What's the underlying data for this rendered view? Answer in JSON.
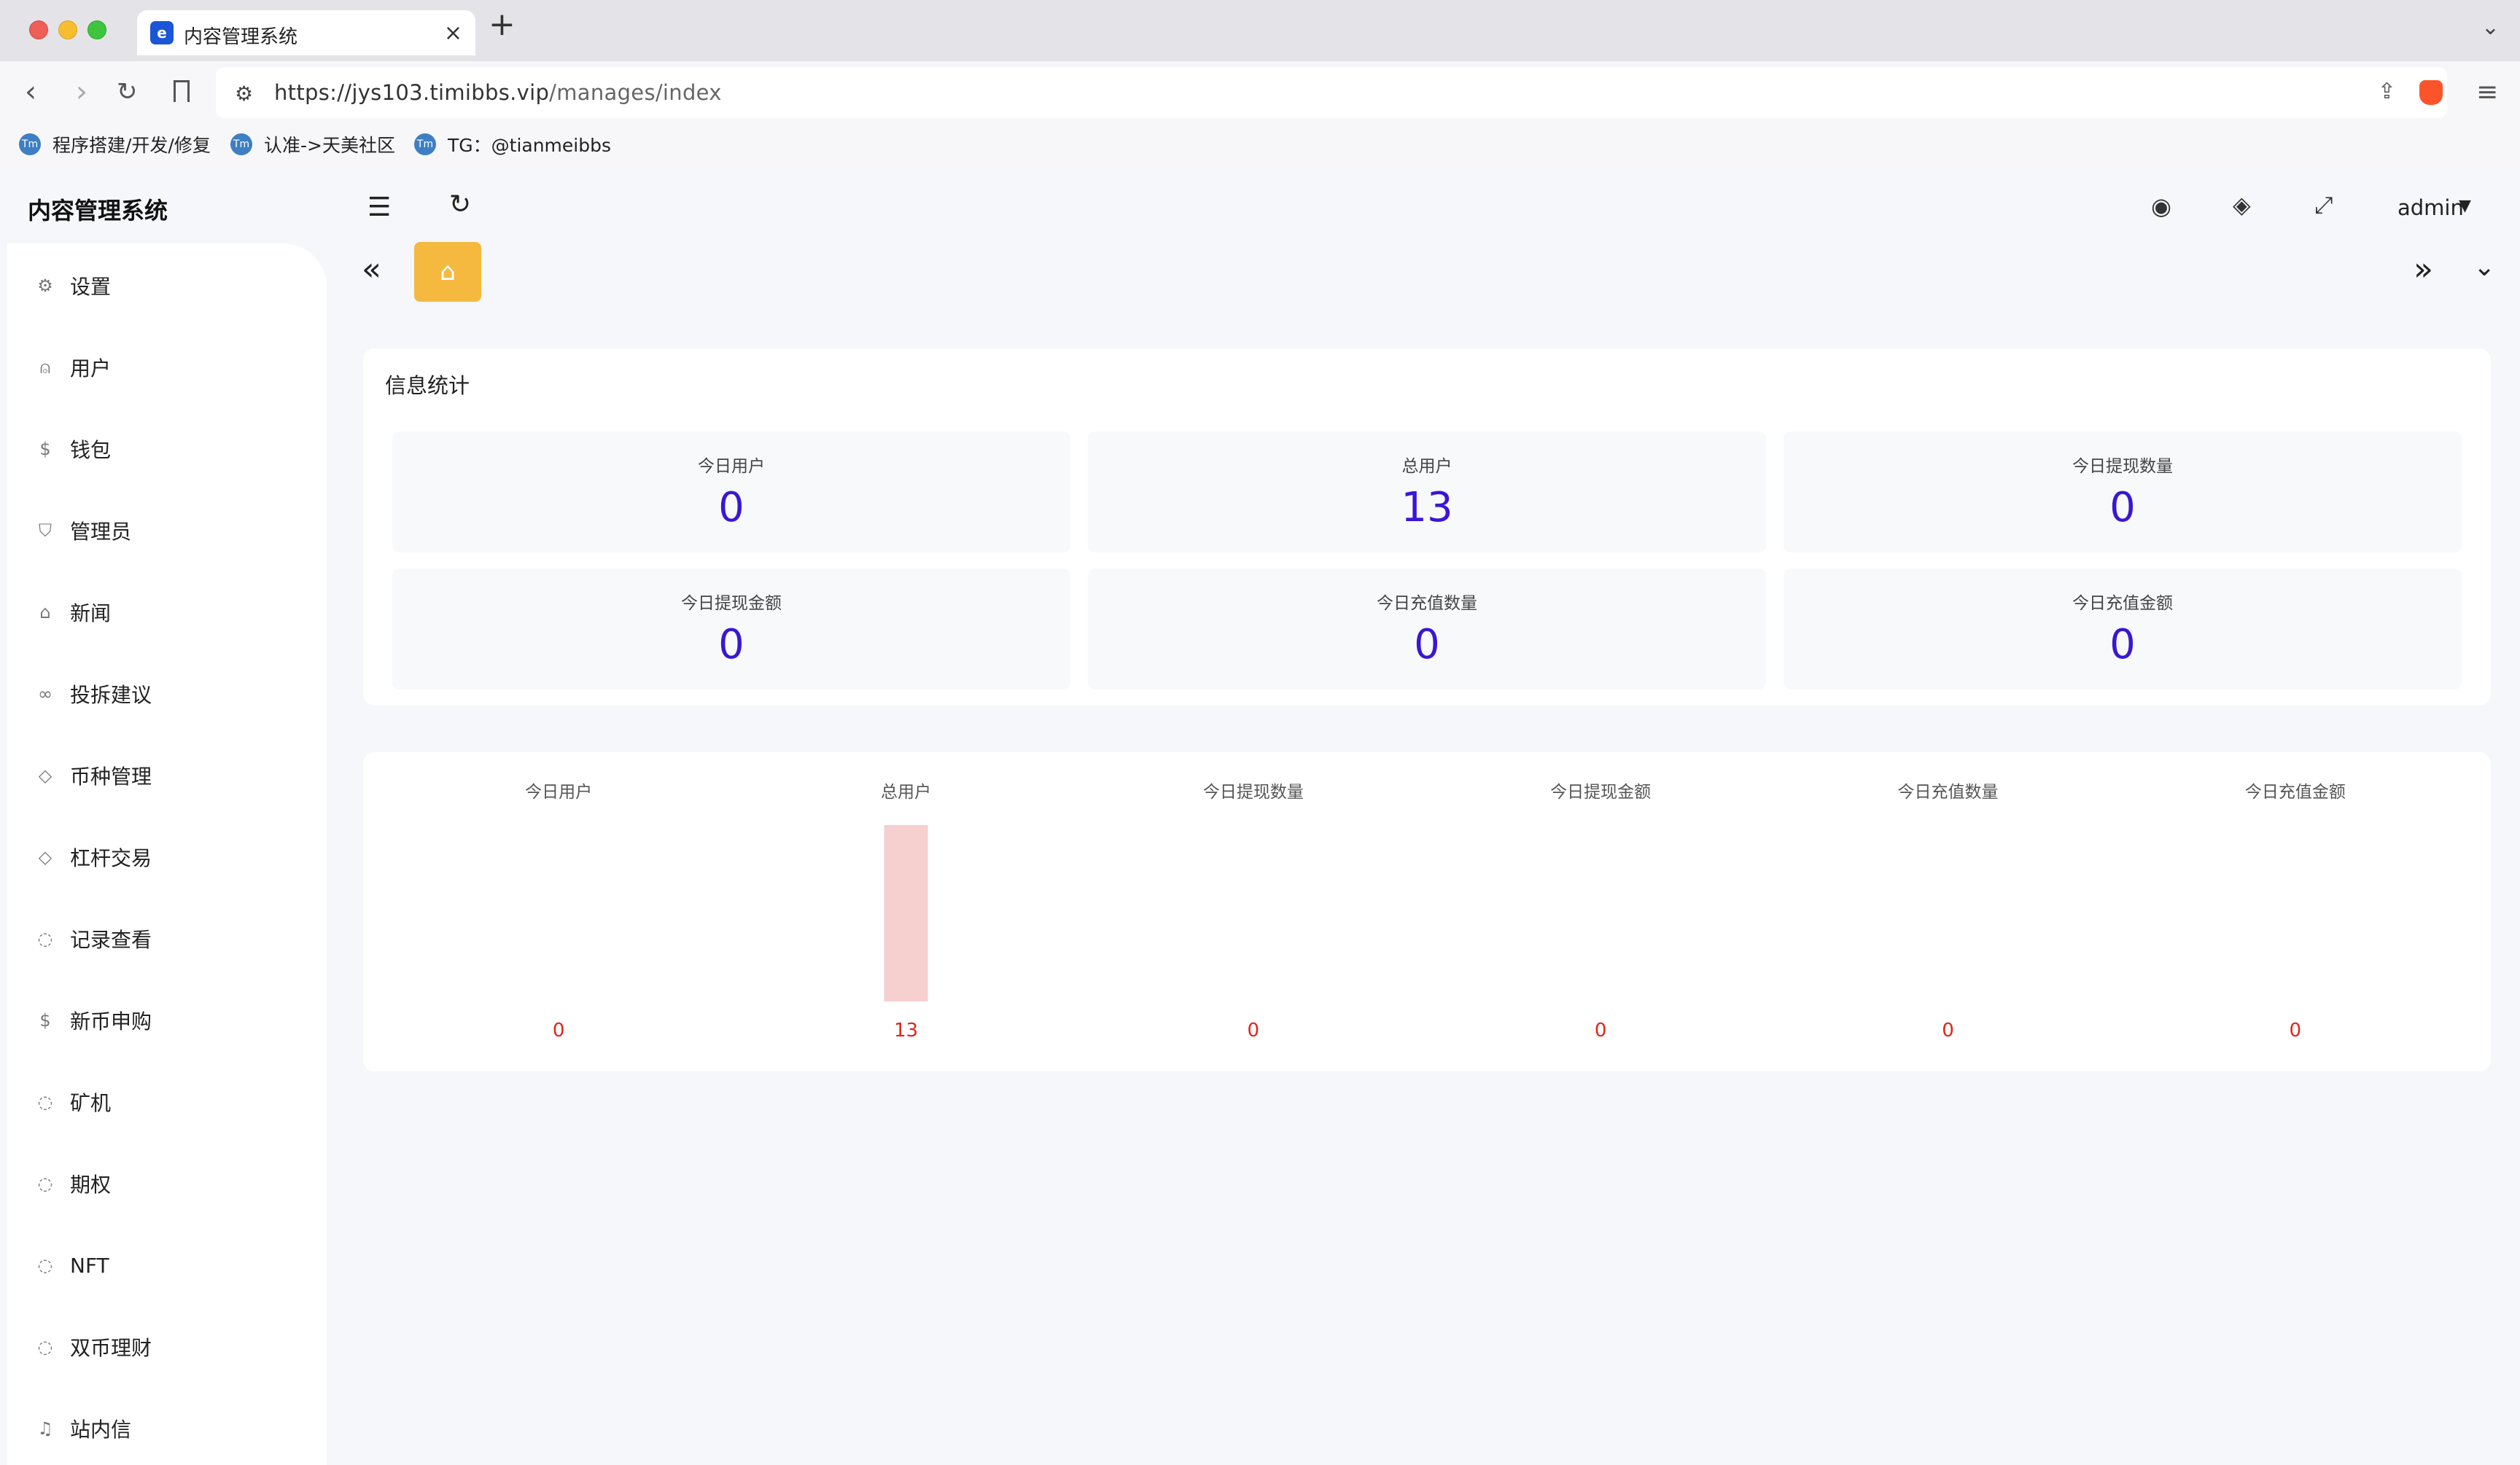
{
  "browser": {
    "tab_title": "内容管理系统",
    "tab_favicon": "e",
    "tab_close": "×",
    "new_tab": "+",
    "tab_menu": "⌄",
    "url_domain": "https://jys103.timibbs.vip",
    "url_path": "/manages/index"
  },
  "bookmarks": [
    {
      "label": "程序搭建/开发/修复",
      "icon": "Tm"
    },
    {
      "label": "认准->天美社区",
      "icon": "Tm"
    },
    {
      "label": "TG：@tianmeibbs",
      "icon": "Tm"
    }
  ],
  "app": {
    "title": "内容管理系统",
    "user": "admin"
  },
  "sidebar": {
    "items": [
      {
        "label": "设置",
        "icon": "gear-icon"
      },
      {
        "label": "用户",
        "icon": "user-icon"
      },
      {
        "label": "钱包",
        "icon": "dollar-icon"
      },
      {
        "label": "管理员",
        "icon": "shield-icon"
      },
      {
        "label": "新闻",
        "icon": "tag-icon"
      },
      {
        "label": "投拆建议",
        "icon": "link-icon"
      },
      {
        "label": "币种管理",
        "icon": "diamond-icon"
      },
      {
        "label": "杠杆交易",
        "icon": "diamond-icon"
      },
      {
        "label": "记录查看",
        "icon": "circle-arrow-icon"
      },
      {
        "label": "新币申购",
        "icon": "dollar-icon"
      },
      {
        "label": "矿机",
        "icon": "circle-arrow-icon"
      },
      {
        "label": "期权",
        "icon": "circle-arrow-icon"
      },
      {
        "label": "NFT",
        "icon": "circle-arrow-icon"
      },
      {
        "label": "双币理财",
        "icon": "circle-arrow-icon"
      },
      {
        "label": "站内信",
        "icon": "bell-icon"
      }
    ]
  },
  "stats": {
    "title": "信息统计",
    "items": [
      {
        "label": "今日用户",
        "value": "0"
      },
      {
        "label": "总用户",
        "value": "13"
      },
      {
        "label": "今日提现数量",
        "value": "0"
      },
      {
        "label": "今日提现金额",
        "value": "0"
      },
      {
        "label": "今日充值数量",
        "value": "0"
      },
      {
        "label": "今日充值金额",
        "value": "0"
      }
    ]
  },
  "colors": {
    "stat_value": "#3a16d6",
    "bar": "#f6cfcf",
    "bar_label": "#e0261a",
    "home_tab": "#f4b93e"
  },
  "chart_data": {
    "type": "bar",
    "categories": [
      "今日用户",
      "总用户",
      "今日提现数量",
      "今日提现金额",
      "今日充值数量",
      "今日充值金额"
    ],
    "values": [
      0,
      13,
      0,
      0,
      0,
      0
    ],
    "title": "",
    "xlabel": "",
    "ylabel": "",
    "ylim": [
      0,
      13
    ],
    "grid": false
  }
}
